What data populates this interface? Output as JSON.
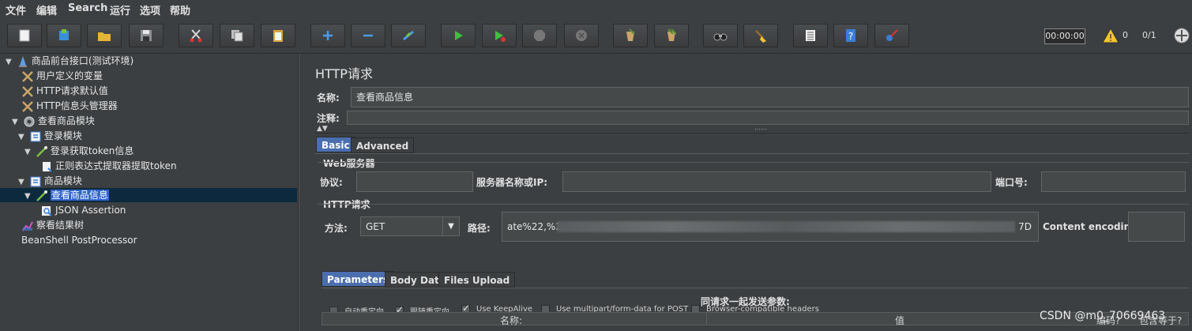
{
  "menu": [
    "文件",
    "编辑",
    "Search",
    "运行",
    "选项",
    "帮助"
  ],
  "toolbar": {
    "buttons": [
      "new-icon",
      "templates-icon",
      "open-icon",
      "save-icon",
      "cut-icon",
      "copy-icon",
      "paste-icon",
      "expand-icon",
      "collapse-icon",
      "toggle-icon",
      "start-icon",
      "start-no-pause-icon",
      "stop-icon",
      "shutdown-icon",
      "clear-icon",
      "clear-all-icon",
      "search-icon",
      "reset-search-icon",
      "function-helper-icon",
      "help-icon",
      "remote-icon"
    ],
    "timer": "00:00:00",
    "warning_count": "0",
    "threads": "0/1"
  },
  "tree": [
    {
      "label": "商品前台接口(测试环境)",
      "icon": "test-plan-icon",
      "expanded": true
    },
    {
      "label": "用户定义的变量",
      "icon": "config-element-icon"
    },
    {
      "label": "HTTP请求默认值",
      "icon": "config-element-icon"
    },
    {
      "label": "HTTP信息头管理器",
      "icon": "config-element-icon"
    },
    {
      "label": "查看商品模块",
      "icon": "thread-group-icon",
      "expanded": true
    },
    {
      "label": "登录模块",
      "icon": "controller-icon",
      "expanded": true
    },
    {
      "label": "登录获取token信息",
      "icon": "sampler-icon",
      "expanded": true
    },
    {
      "label": "正则表达式提取器提取token",
      "icon": "extractor-icon"
    },
    {
      "label": "商品模块",
      "icon": "controller-icon",
      "expanded": true
    },
    {
      "label": "查看商品信息",
      "icon": "sampler-icon",
      "expanded": true,
      "selected": true
    },
    {
      "label": "JSON Assertion",
      "icon": "assertion-icon"
    },
    {
      "label": "察看结果树",
      "icon": "listener-icon"
    },
    {
      "label": "BeanShell PostProcessor",
      "icon": "postprocessor-icon"
    }
  ],
  "panel": {
    "title": "HTTP请求",
    "name_label": "名称:",
    "name_value": "查看商品信息",
    "comment_label": "注释:",
    "comment_value": "",
    "tabs": [
      "Basic",
      "Advanced"
    ],
    "web_server": {
      "title": "Web服务器",
      "protocol_label": "协议:",
      "protocol_value": "",
      "server_label": "服务器名称或IP:",
      "server_value": "",
      "port_label": "端口号:",
      "port_value": ""
    },
    "http_request": {
      "title": "HTTP请求",
      "method_label": "方法:",
      "method_value": "GET",
      "path_label": "路径:",
      "path_start": "ate%22,%2",
      "path_end": "7D",
      "encoding_label": "Content encoding:",
      "encoding_value": ""
    },
    "options": [
      {
        "label": "自动重定向",
        "checked": false
      },
      {
        "label": "跟随重定向",
        "checked": true
      },
      {
        "label": "Use KeepAlive",
        "checked": true
      },
      {
        "label": "Use multipart/form-data for POST",
        "checked": false
      },
      {
        "label": "Browser-compatible headers",
        "checked": false
      }
    ],
    "param_tabs": [
      "Parameters",
      "Body Data",
      "Files Upload"
    ],
    "params_title": "同请求一起发送参数:",
    "params_columns": [
      "名称:",
      "值",
      "编码?",
      "包含等于?"
    ]
  },
  "watermark": "CSDN @m0_70669463",
  "colors": {
    "background": "#3c3f41",
    "selection": "#2f65ca",
    "active_tab": "#4b6eaf"
  }
}
